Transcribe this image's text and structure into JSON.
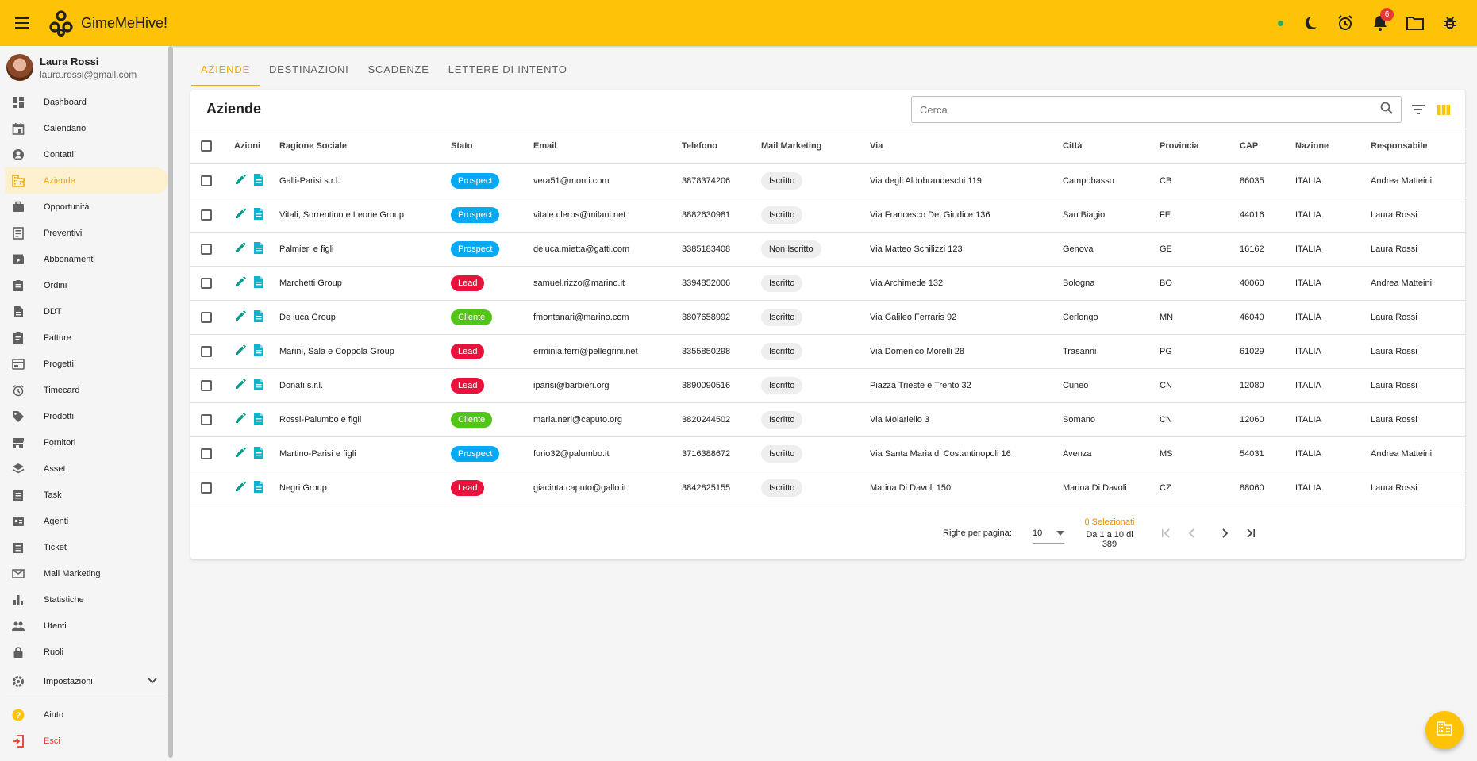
{
  "app": {
    "title": "GimeMeHive!"
  },
  "header": {
    "notifications_count": "6"
  },
  "user": {
    "name": "Laura Rossi",
    "email": "laura.rossi@gmail.com"
  },
  "sidebar": {
    "items": [
      {
        "label": "Dashboard",
        "icon": "dashboard-icon"
      },
      {
        "label": "Calendario",
        "icon": "calendar-icon"
      },
      {
        "label": "Contatti",
        "icon": "account-circle-icon"
      },
      {
        "label": "Aziende",
        "icon": "domain-icon",
        "active": true
      },
      {
        "label": "Opportunità",
        "icon": "briefcase-icon"
      },
      {
        "label": "Preventivi",
        "icon": "receipt-icon"
      },
      {
        "label": "Abbonamenti",
        "icon": "subscriptions-icon"
      },
      {
        "label": "Ordini",
        "icon": "clipboard-icon"
      },
      {
        "label": "DDT",
        "icon": "document-icon"
      },
      {
        "label": "Fatture",
        "icon": "invoice-icon"
      },
      {
        "label": "Progetti",
        "icon": "projects-icon"
      },
      {
        "label": "Timecard",
        "icon": "alarm-icon"
      },
      {
        "label": "Prodotti",
        "icon": "tag-icon"
      },
      {
        "label": "Fornitori",
        "icon": "store-icon"
      },
      {
        "label": "Asset",
        "icon": "layers-icon"
      },
      {
        "label": "Task",
        "icon": "task-icon"
      },
      {
        "label": "Agenti",
        "icon": "badge-icon"
      },
      {
        "label": "Ticket",
        "icon": "ticket-icon"
      },
      {
        "label": "Mail Marketing",
        "icon": "mail-icon"
      },
      {
        "label": "Statistiche",
        "icon": "bar-chart-icon"
      },
      {
        "label": "Utenti",
        "icon": "people-icon"
      },
      {
        "label": "Ruoli",
        "icon": "lock-icon"
      }
    ],
    "settings": "Impostazioni",
    "help": "Aiuto",
    "logout": "Esci"
  },
  "tabs": [
    "AZIENDE",
    "DESTINAZIONI",
    "SCADENZE",
    "LETTERE DI INTENTO"
  ],
  "card": {
    "title": "Aziende",
    "search_placeholder": "Cerca"
  },
  "table": {
    "columns": [
      "Azioni",
      "Ragione Sociale",
      "Stato",
      "Email",
      "Telefono",
      "Mail Marketing",
      "Via",
      "Città",
      "Provincia",
      "CAP",
      "Nazione",
      "Responsabile"
    ],
    "rows": [
      [
        "Galli-Parisi s.r.l.",
        "Prospect",
        "vera51@monti.com",
        "3878374206",
        "Iscritto",
        "Via degli Aldobrandeschi 119",
        "Campobasso",
        "CB",
        "86035",
        "ITALIA",
        "Andrea Matteini"
      ],
      [
        "Vitali, Sorrentino e Leone Group",
        "Prospect",
        "vitale.cleros@milani.net",
        "3882630981",
        "Iscritto",
        "Via Francesco Del Giudice 136",
        "San Biagio",
        "FE",
        "44016",
        "ITALIA",
        "Laura Rossi"
      ],
      [
        "Palmieri e figli",
        "Prospect",
        "deluca.mietta@gatti.com",
        "3385183408",
        "Non Iscritto",
        "Via Matteo Schilizzi 123",
        "Genova",
        "GE",
        "16162",
        "ITALIA",
        "Laura Rossi"
      ],
      [
        "Marchetti Group",
        "Lead",
        "samuel.rizzo@marino.it",
        "3394852006",
        "Iscritto",
        "Via Archimede 132",
        "Bologna",
        "BO",
        "40060",
        "ITALIA",
        "Andrea Matteini"
      ],
      [
        "De luca Group",
        "Cliente",
        "fmontanari@marino.com",
        "3807658992",
        "Iscritto",
        "Via Galileo Ferraris 92",
        "Cerlongo",
        "MN",
        "46040",
        "ITALIA",
        "Laura Rossi"
      ],
      [
        "Marini, Sala e Coppola Group",
        "Lead",
        "erminia.ferri@pellegrini.net",
        "3355850298",
        "Iscritto",
        "Via Domenico Morelli 28",
        "Trasanni",
        "PG",
        "61029",
        "ITALIA",
        "Laura Rossi"
      ],
      [
        "Donati s.r.l.",
        "Lead",
        "iparisi@barbieri.org",
        "3890090516",
        "Iscritto",
        "Piazza Trieste e Trento 32",
        "Cuneo",
        "CN",
        "12080",
        "ITALIA",
        "Laura Rossi"
      ],
      [
        "Rossi-Palumbo e figli",
        "Cliente",
        "maria.neri@caputo.org",
        "3820244502",
        "Iscritto",
        "Via Moiariello 3",
        "Somano",
        "CN",
        "12060",
        "ITALIA",
        "Laura Rossi"
      ],
      [
        "Martino-Parisi e figli",
        "Prospect",
        "furio32@palumbo.it",
        "3716388672",
        "Iscritto",
        "Via Santa Maria di Costantinopoli 16",
        "Avenza",
        "MS",
        "54031",
        "ITALIA",
        "Andrea Matteini"
      ],
      [
        "Negri Group",
        "Lead",
        "giacinta.caputo@gallo.it",
        "3842825155",
        "Iscritto",
        "Marina Di Davoli 150",
        "Marina Di Davoli",
        "CZ",
        "88060",
        "ITALIA",
        "Laura Rossi"
      ]
    ]
  },
  "pagination": {
    "rows_per_page_label": "Righe per pagina:",
    "rows_per_page": "10",
    "selected": "0 Selezionati",
    "range": "Da 1 a 10 di 389"
  },
  "colors": {
    "accent": "#fec307",
    "prospect": "#05a9f4",
    "lead": "#e8123c",
    "cliente": "#52c41a",
    "action": "#0b9b8a"
  }
}
